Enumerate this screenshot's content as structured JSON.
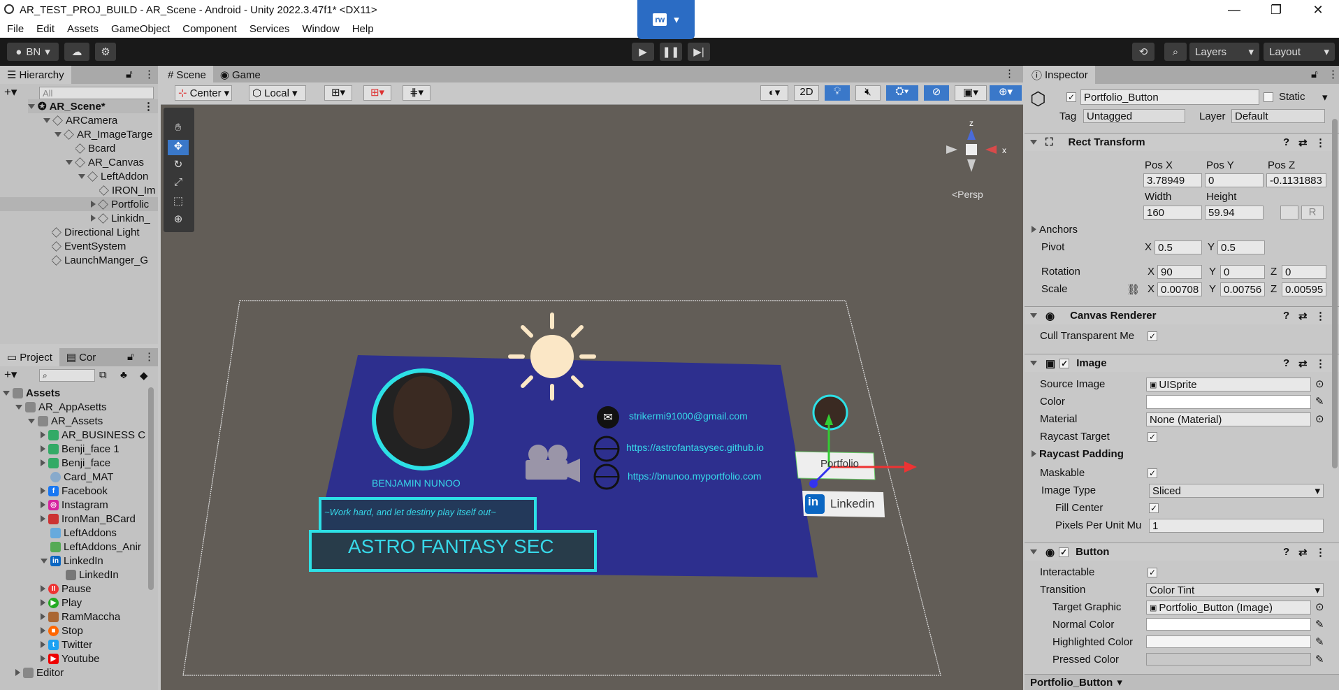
{
  "window": {
    "title": "AR_TEST_PROJ_BUILD - AR_Scene - Android - Unity 2022.3.47f1* <DX11>",
    "min": "—",
    "max": "❐",
    "close": "✕"
  },
  "menu": [
    "File",
    "Edit",
    "Assets",
    "GameObject",
    "Component",
    "Services",
    "Window",
    "Help"
  ],
  "toolbar": {
    "account": "BN",
    "layers": "Layers",
    "layout": "Layout",
    "rw": "rw"
  },
  "hierarchy": {
    "title": "Hierarchy",
    "search_placeholder": "All",
    "scene": "AR_Scene*",
    "items": [
      "ARCamera",
      "AR_ImageTarge",
      "Bcard",
      "AR_Canvas",
      "LeftAddon",
      "IRON_Im",
      "Portfolic",
      "Linkidn_",
      "Directional Light",
      "EventSystem",
      "LaunchManger_G"
    ]
  },
  "project": {
    "title": "Project",
    "tab2": "Cor",
    "root": "Assets",
    "items": [
      "AR_AppAsetts",
      "AR_Assets",
      "AR_BUSINESS C",
      "Benji_face 1",
      "Benji_face",
      "Card_MAT",
      "Facebook",
      "Instagram",
      "IronMan_BCard",
      "LeftAddons",
      "LeftAddons_Anir",
      "LinkedIn",
      "LinkedIn",
      "Pause",
      "Play",
      "RamMaccha",
      "Stop",
      "Twitter",
      "Youtube",
      "Editor"
    ]
  },
  "scene_view": {
    "tab_scene": "Scene",
    "tab_game": "Game",
    "pivot": "Center",
    "space": "Local",
    "mode2d": "2D",
    "persp": "<Persp",
    "card": {
      "email": "strikermi91000@gmail.com",
      "site1": "https://astrofantasysec.github.io",
      "site2": "https://bnunoo.myportfolio.com",
      "name": "BENJAMIN NUNOO",
      "motto": "~Work hard, and let destiny play itself out~",
      "company": "ASTRO FANTASY SEC",
      "portfolio": "Portfolio",
      "linkedin": "Linkedin",
      "li": "in"
    }
  },
  "inspector": {
    "title": "Inspector",
    "object_name": "Portfolio_Button",
    "static": "Static",
    "tag_label": "Tag",
    "tag": "Untagged",
    "layer_label": "Layer",
    "layer": "Default",
    "rect": {
      "title": "Rect Transform",
      "posx_l": "Pos X",
      "posy_l": "Pos Y",
      "posz_l": "Pos Z",
      "posx": "3.78949",
      "posy": "0",
      "posz": "-0.1131883",
      "width_l": "Width",
      "height_l": "Height",
      "width": "160",
      "height": "59.94",
      "anchors": "Anchors",
      "pivot": "Pivot",
      "pivot_x": "0.5",
      "pivot_y": "0.5",
      "rotation": "Rotation",
      "rot_x": "90",
      "rot_y": "0",
      "rot_z": "0",
      "scale": "Scale",
      "scale_x": "0.00708",
      "scale_y": "0.00756",
      "scale_z": "0.00595",
      "X": "X",
      "Y": "Y",
      "Z": "Z",
      "R": "R"
    },
    "canvas_renderer": {
      "title": "Canvas Renderer",
      "cull": "Cull Transparent Me"
    },
    "image": {
      "title": "Image",
      "source_l": "Source Image",
      "source": "UISprite",
      "color_l": "Color",
      "material_l": "Material",
      "material": "None (Material)",
      "raycast_target": "Raycast Target",
      "raycast_padding": "Raycast Padding",
      "maskable": "Maskable",
      "type_l": "Image Type",
      "type": "Sliced",
      "fill_center": "Fill Center",
      "ppu_l": "Pixels Per Unit Mu",
      "ppu": "1"
    },
    "button": {
      "title": "Button",
      "interactable": "Interactable",
      "transition_l": "Transition",
      "transition": "Color Tint",
      "target_l": "Target Graphic",
      "target": "Portfolio_Button (Image)",
      "normal": "Normal Color",
      "highlighted": "Highlighted Color",
      "pressed": "Pressed Color"
    },
    "footer": "Portfolio_Button"
  }
}
